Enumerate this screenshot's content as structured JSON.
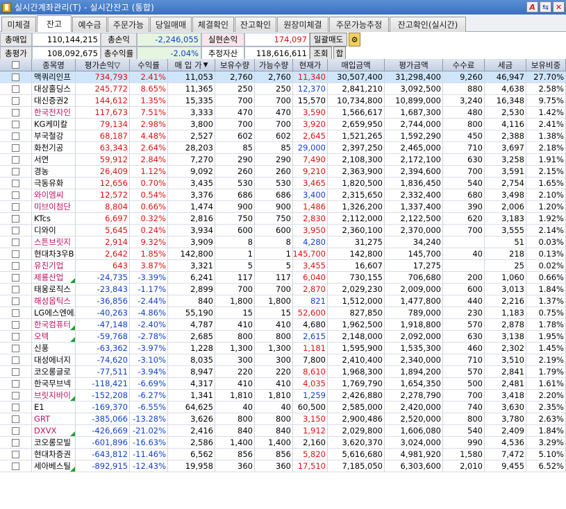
{
  "window": {
    "title": "실시간계좌관리(T) - 실시간잔고 (통합)",
    "icon": "app-icon",
    "btn1": "A",
    "btn2": "⇆",
    "btn3": "✕"
  },
  "tabs": [
    "미체결",
    "잔고",
    "예수금",
    "주문가능",
    "당일매매",
    "체결확인",
    "잔고확인",
    "원장미체결",
    "주문가능추정",
    "잔고확인(실시간)"
  ],
  "summary": {
    "total_buy_label": "총매입",
    "total_buy": "110,144,215",
    "total_pl_label": "총손익",
    "total_pl": "-2,246,055",
    "realized_label": "실현손익",
    "realized": "174,097",
    "batch_sell": "일괄매도",
    "total_eval_label": "총평가",
    "total_eval": "108,092,675",
    "total_rate_label": "총수익률",
    "total_rate": "-2.04%",
    "est_asset_label": "추정자산",
    "est_asset": "118,616,611",
    "query_btn": "조회",
    "sum_btn": "합"
  },
  "columns": [
    "종목명",
    "평가손익▽",
    "수익률",
    "매 입 가",
    "보유수량",
    "가능수량",
    "현재가",
    "매입금액",
    "평가금액",
    "수수료",
    "세금",
    "보유비중"
  ],
  "rows": [
    {
      "name": "맥쿼리인프",
      "pl": "734,793",
      "rate": "2.41%",
      "buy": "11,053",
      "qty": "2,760",
      "avail": "2,760",
      "cur": "11,340",
      "buyamt": "30,507,400",
      "evalamt": "31,298,400",
      "fee": "9,260",
      "tax": "46,947",
      "weight": "27.70%",
      "cc": "red",
      "nc": "",
      "sel": true,
      "flag": false
    },
    {
      "name": "대상홀딩스",
      "pl": "245,772",
      "rate": "8.65%",
      "buy": "11,365",
      "qty": "250",
      "avail": "250",
      "cur": "12,370",
      "buyamt": "2,841,210",
      "evalamt": "3,092,500",
      "fee": "880",
      "tax": "4,638",
      "weight": "2.58%",
      "cc": "blue",
      "nc": "",
      "sel": false,
      "flag": false
    },
    {
      "name": "대신증권2",
      "pl": "144,612",
      "rate": "1.35%",
      "buy": "15,335",
      "qty": "700",
      "avail": "700",
      "cur": "15,570",
      "buyamt": "10,734,800",
      "evalamt": "10,899,000",
      "fee": "3,240",
      "tax": "16,348",
      "weight": "9.75%",
      "cc": "",
      "nc": "",
      "sel": false,
      "flag": false
    },
    {
      "name": "한국전자인",
      "pl": "117,673",
      "rate": "7.51%",
      "buy": "3,333",
      "qty": "470",
      "avail": "470",
      "cur": "3,590",
      "buyamt": "1,566,617",
      "evalamt": "1,687,300",
      "fee": "480",
      "tax": "2,530",
      "weight": "1.42%",
      "cc": "red",
      "nc": "pinkname",
      "sel": false,
      "flag": false
    },
    {
      "name": "KG케미칼",
      "pl": "79,134",
      "rate": "2.98%",
      "buy": "3,800",
      "qty": "700",
      "avail": "700",
      "cur": "3,920",
      "buyamt": "2,659,950",
      "evalamt": "2,744,000",
      "fee": "800",
      "tax": "4,116",
      "weight": "2.41%",
      "cc": "red",
      "nc": "",
      "sel": false,
      "flag": false
    },
    {
      "name": "부국철강",
      "pl": "68,187",
      "rate": "4.48%",
      "buy": "2,527",
      "qty": "602",
      "avail": "602",
      "cur": "2,645",
      "buyamt": "1,521,265",
      "evalamt": "1,592,290",
      "fee": "450",
      "tax": "2,388",
      "weight": "1.38%",
      "cc": "red",
      "nc": "",
      "sel": false,
      "flag": false
    },
    {
      "name": "화천기공",
      "pl": "63,343",
      "rate": "2.64%",
      "buy": "28,203",
      "qty": "85",
      "avail": "85",
      "cur": "29,000",
      "buyamt": "2,397,250",
      "evalamt": "2,465,000",
      "fee": "710",
      "tax": "3,697",
      "weight": "2.18%",
      "cc": "blue",
      "nc": "",
      "sel": false,
      "flag": false
    },
    {
      "name": "서연",
      "pl": "59,912",
      "rate": "2.84%",
      "buy": "7,270",
      "qty": "290",
      "avail": "290",
      "cur": "7,490",
      "buyamt": "2,108,300",
      "evalamt": "2,172,100",
      "fee": "630",
      "tax": "3,258",
      "weight": "1.91%",
      "cc": "red",
      "nc": "",
      "sel": false,
      "flag": false
    },
    {
      "name": "경농",
      "pl": "26,409",
      "rate": "1.12%",
      "buy": "9,092",
      "qty": "260",
      "avail": "260",
      "cur": "9,210",
      "buyamt": "2,363,900",
      "evalamt": "2,394,600",
      "fee": "700",
      "tax": "3,591",
      "weight": "2.15%",
      "cc": "red",
      "nc": "",
      "sel": false,
      "flag": false
    },
    {
      "name": "극동유화",
      "pl": "12,656",
      "rate": "0.70%",
      "buy": "3,435",
      "qty": "530",
      "avail": "530",
      "cur": "3,465",
      "buyamt": "1,820,500",
      "evalamt": "1,836,450",
      "fee": "540",
      "tax": "2,754",
      "weight": "1.65%",
      "cc": "red",
      "nc": "",
      "sel": false,
      "flag": false
    },
    {
      "name": "와이엠씨",
      "pl": "12,572",
      "rate": "0.54%",
      "buy": "3,376",
      "qty": "686",
      "avail": "686",
      "cur": "3,400",
      "buyamt": "2,315,650",
      "evalamt": "2,332,400",
      "fee": "680",
      "tax": "3,498",
      "weight": "2.10%",
      "cc": "blue",
      "nc": "pinkname",
      "sel": false,
      "flag": false
    },
    {
      "name": "미브이첨단",
      "pl": "8,804",
      "rate": "0.66%",
      "buy": "1,474",
      "qty": "900",
      "avail": "900",
      "cur": "1,486",
      "buyamt": "1,326,200",
      "evalamt": "1,337,400",
      "fee": "390",
      "tax": "2,006",
      "weight": "1.20%",
      "cc": "red",
      "nc": "pinkname",
      "sel": false,
      "flag": false
    },
    {
      "name": "KTcs",
      "pl": "6,697",
      "rate": "0.32%",
      "buy": "2,816",
      "qty": "750",
      "avail": "750",
      "cur": "2,830",
      "buyamt": "2,112,000",
      "evalamt": "2,122,500",
      "fee": "620",
      "tax": "3,183",
      "weight": "1.92%",
      "cc": "red",
      "nc": "",
      "sel": false,
      "flag": false
    },
    {
      "name": "디와이",
      "pl": "5,645",
      "rate": "0.24%",
      "buy": "3,934",
      "qty": "600",
      "avail": "600",
      "cur": "3,950",
      "buyamt": "2,360,100",
      "evalamt": "2,370,000",
      "fee": "700",
      "tax": "3,555",
      "weight": "2.14%",
      "cc": "red",
      "nc": "",
      "sel": false,
      "flag": false
    },
    {
      "name": "스튼브릿지",
      "pl": "2,914",
      "rate": "9.32%",
      "buy": "3,909",
      "qty": "8",
      "avail": "8",
      "cur": "4,280",
      "buyamt": "31,275",
      "evalamt": "34,240",
      "fee": "",
      "tax": "51",
      "weight": "0.03%",
      "cc": "blue",
      "nc": "pinkname",
      "sel": false,
      "flag": false
    },
    {
      "name": "현대차3우B",
      "pl": "2,642",
      "rate": "1.85%",
      "buy": "142,800",
      "qty": "1",
      "avail": "1",
      "cur": "145,700",
      "buyamt": "142,800",
      "evalamt": "145,700",
      "fee": "40",
      "tax": "218",
      "weight": "0.13%",
      "cc": "red",
      "nc": "",
      "sel": false,
      "flag": false
    },
    {
      "name": "유진기업",
      "pl": "643",
      "rate": "3.87%",
      "buy": "3,321",
      "qty": "5",
      "avail": "5",
      "cur": "3,455",
      "buyamt": "16,607",
      "evalamt": "17,275",
      "fee": "",
      "tax": "25",
      "weight": "0.02%",
      "cc": "red",
      "nc": "pinkname",
      "sel": false,
      "flag": false
    },
    {
      "name": "제룡산업",
      "pl": "-24,735",
      "rate": "-3.39%",
      "buy": "6,241",
      "qty": "117",
      "avail": "117",
      "cur": "6,040",
      "buyamt": "730,155",
      "evalamt": "706,680",
      "fee": "200",
      "tax": "1,060",
      "weight": "0.66%",
      "cc": "red",
      "nc": "pinkname",
      "sel": false,
      "flag": true
    },
    {
      "name": "태웅로직스",
      "pl": "-23,843",
      "rate": "-1.17%",
      "buy": "2,899",
      "qty": "700",
      "avail": "700",
      "cur": "2,870",
      "buyamt": "2,029,230",
      "evalamt": "2,009,000",
      "fee": "600",
      "tax": "3,013",
      "weight": "1.84%",
      "cc": "red",
      "nc": "",
      "sel": false,
      "flag": false
    },
    {
      "name": "해성옵틱스",
      "pl": "-36,856",
      "rate": "-2.44%",
      "buy": "840",
      "qty": "1,800",
      "avail": "1,800",
      "cur": "821",
      "buyamt": "1,512,000",
      "evalamt": "1,477,800",
      "fee": "440",
      "tax": "2,216",
      "weight": "1.37%",
      "cc": "blue",
      "nc": "pinkname",
      "sel": false,
      "flag": false
    },
    {
      "name": "LG에스엔에스",
      "pl": "-40,263",
      "rate": "-4.86%",
      "buy": "55,190",
      "qty": "15",
      "avail": "15",
      "cur": "52,600",
      "buyamt": "827,850",
      "evalamt": "789,000",
      "fee": "230",
      "tax": "1,183",
      "weight": "0.75%",
      "cc": "red",
      "nc": "",
      "sel": false,
      "flag": false
    },
    {
      "name": "한국컴퓨터",
      "pl": "-47,148",
      "rate": "-2.40%",
      "buy": "4,787",
      "qty": "410",
      "avail": "410",
      "cur": "4,680",
      "buyamt": "1,962,500",
      "evalamt": "1,918,800",
      "fee": "570",
      "tax": "2,878",
      "weight": "1.78%",
      "cc": "",
      "nc": "pinkname",
      "sel": false,
      "flag": true
    },
    {
      "name": "오텍",
      "pl": "-59,768",
      "rate": "-2.78%",
      "buy": "2,685",
      "qty": "800",
      "avail": "800",
      "cur": "2,615",
      "buyamt": "2,148,000",
      "evalamt": "2,092,000",
      "fee": "630",
      "tax": "3,138",
      "weight": "1.95%",
      "cc": "blue",
      "nc": "pinkname",
      "sel": false,
      "flag": true
    },
    {
      "name": "신풍",
      "pl": "-63,362",
      "rate": "-3.97%",
      "buy": "1,228",
      "qty": "1,300",
      "avail": "1,300",
      "cur": "1,181",
      "buyamt": "1,595,900",
      "evalamt": "1,535,300",
      "fee": "460",
      "tax": "2,302",
      "weight": "1.45%",
      "cc": "red",
      "nc": "",
      "sel": false,
      "flag": false
    },
    {
      "name": "대성에너지",
      "pl": "-74,620",
      "rate": "-3.10%",
      "buy": "8,035",
      "qty": "300",
      "avail": "300",
      "cur": "7,800",
      "buyamt": "2,410,400",
      "evalamt": "2,340,000",
      "fee": "710",
      "tax": "3,510",
      "weight": "2.19%",
      "cc": "",
      "nc": "",
      "sel": false,
      "flag": false
    },
    {
      "name": "코오롱글로",
      "pl": "-77,511",
      "rate": "-3.94%",
      "buy": "8,947",
      "qty": "220",
      "avail": "220",
      "cur": "8,610",
      "buyamt": "1,968,300",
      "evalamt": "1,894,200",
      "fee": "570",
      "tax": "2,841",
      "weight": "1.79%",
      "cc": "red",
      "nc": "",
      "sel": false,
      "flag": false
    },
    {
      "name": "한국무브넥",
      "pl": "-118,421",
      "rate": "-6.69%",
      "buy": "4,317",
      "qty": "410",
      "avail": "410",
      "cur": "4,035",
      "buyamt": "1,769,790",
      "evalamt": "1,654,350",
      "fee": "500",
      "tax": "2,481",
      "weight": "1.61%",
      "cc": "red",
      "nc": "",
      "sel": false,
      "flag": false
    },
    {
      "name": "브릿지바이",
      "pl": "-152,208",
      "rate": "-6.27%",
      "buy": "1,341",
      "qty": "1,810",
      "avail": "1,810",
      "cur": "1,259",
      "buyamt": "2,426,880",
      "evalamt": "2,278,790",
      "fee": "700",
      "tax": "3,418",
      "weight": "2.20%",
      "cc": "blue",
      "nc": "pinkname",
      "sel": false,
      "flag": true
    },
    {
      "name": "E1",
      "pl": "-169,370",
      "rate": "-6.55%",
      "buy": "64,625",
      "qty": "40",
      "avail": "40",
      "cur": "60,500",
      "buyamt": "2,585,000",
      "evalamt": "2,420,000",
      "fee": "740",
      "tax": "3,630",
      "weight": "2.35%",
      "cc": "",
      "nc": "",
      "sel": false,
      "flag": false
    },
    {
      "name": "GRT",
      "pl": "-385,066",
      "rate": "-13.28%",
      "buy": "3,626",
      "qty": "800",
      "avail": "800",
      "cur": "3,150",
      "buyamt": "2,900,486",
      "evalamt": "2,520,000",
      "fee": "800",
      "tax": "3,780",
      "weight": "2.63%",
      "cc": "red",
      "nc": "pinkname",
      "sel": false,
      "flag": false
    },
    {
      "name": "DXVX",
      "pl": "-426,669",
      "rate": "-21.02%",
      "buy": "2,416",
      "qty": "840",
      "avail": "840",
      "cur": "1,912",
      "buyamt": "2,029,800",
      "evalamt": "1,606,080",
      "fee": "540",
      "tax": "2,409",
      "weight": "1.84%",
      "cc": "red",
      "nc": "pinkname",
      "sel": false,
      "flag": true
    },
    {
      "name": "코오롱모빌",
      "pl": "-601,896",
      "rate": "-16.63%",
      "buy": "2,586",
      "qty": "1,400",
      "avail": "1,400",
      "cur": "2,160",
      "buyamt": "3,620,370",
      "evalamt": "3,024,000",
      "fee": "990",
      "tax": "4,536",
      "weight": "3.29%",
      "cc": "",
      "nc": "",
      "sel": false,
      "flag": false
    },
    {
      "name": "현대차증권",
      "pl": "-643,812",
      "rate": "-11.46%",
      "buy": "6,562",
      "qty": "856",
      "avail": "856",
      "cur": "5,820",
      "buyamt": "5,616,680",
      "evalamt": "4,981,920",
      "fee": "1,580",
      "tax": "7,472",
      "weight": "5.10%",
      "cc": "red",
      "nc": "",
      "sel": false,
      "flag": false
    },
    {
      "name": "세아베스틸",
      "pl": "-892,915",
      "rate": "-12.43%",
      "buy": "19,958",
      "qty": "360",
      "avail": "360",
      "cur": "17,510",
      "buyamt": "7,185,050",
      "evalamt": "6,303,600",
      "fee": "2,010",
      "tax": "9,455",
      "weight": "6.52%",
      "cc": "red",
      "nc": "",
      "sel": false,
      "flag": true
    }
  ]
}
